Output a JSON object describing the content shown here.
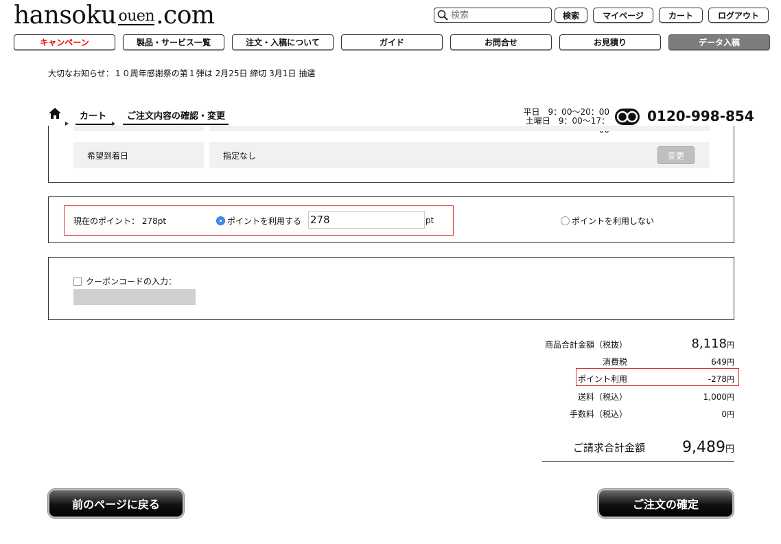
{
  "header": {
    "logo_main": "hansoku",
    "logo_sub": "ouen",
    "logo_tld": ".com",
    "search_placeholder": "検索",
    "search_button": "検索",
    "mypage": "マイページ",
    "cart": "カート",
    "logout": "ログアウト"
  },
  "nav": {
    "items": [
      "キャンペーン",
      "製品・サービス一覧",
      "注文・入稿について",
      "ガイド",
      "お問合せ",
      "お見積り",
      "データ入稿"
    ],
    "campaign_color": "#e00000"
  },
  "notice": "大切なお知らせ：１０周年感謝祭の第１弾は 2月25日 締切 3月1日 抽選",
  "breadcrumb": {
    "items": [
      "カート",
      "ご注文内容の確認・変更"
    ]
  },
  "contact": {
    "weekday": "平日　9：00〜20：00",
    "weekend": "土曜日　9：00〜17：00",
    "phone": "0120-998-854"
  },
  "delivery": {
    "label": "希望到着日",
    "value": "指定なし",
    "change_button": "変更"
  },
  "points": {
    "current_label": "現在のポイント：",
    "current_value": "278pt",
    "use_label": "ポイントを利用する",
    "input_value": "278",
    "unit": "pt",
    "no_use_label": "ポイントを利用しない"
  },
  "coupon": {
    "label": "クーポンコードの入力："
  },
  "totals": {
    "subtotal_label": "商品合計金額（税抜）",
    "subtotal_value": "8,118",
    "tax_label": "消費税",
    "tax_value": "649",
    "points_label": "ポイント利用",
    "points_value": "-278",
    "shipping_label": "送料（税込）",
    "shipping_value": "1,000",
    "fee_label": "手数料（税込）",
    "fee_value": "0",
    "total_label": "ご請求合計金額",
    "total_value": "9,489",
    "currency": "円"
  },
  "buttons": {
    "back": "前のページに戻る",
    "confirm": "ご注文の確定"
  }
}
